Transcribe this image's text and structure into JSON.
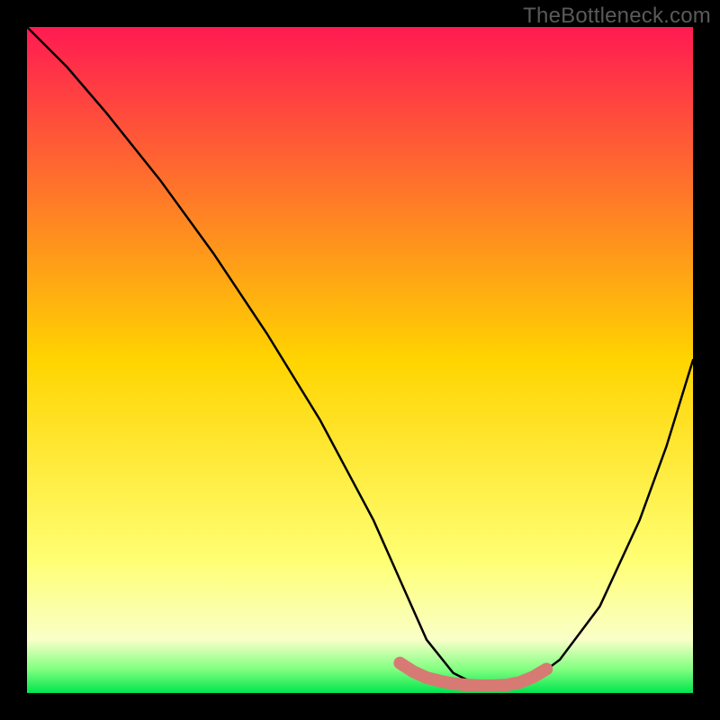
{
  "watermark": "TheBottleneck.com",
  "chart_data": {
    "type": "line",
    "title": "",
    "xlabel": "",
    "ylabel": "",
    "xlim": [
      0,
      100
    ],
    "ylim": [
      0,
      100
    ],
    "grid": false,
    "legend": false,
    "background_gradient": {
      "stops": [
        {
          "offset": 0.0,
          "color": "#ff1a52"
        },
        {
          "offset": 0.5,
          "color": "#ffd400"
        },
        {
          "offset": 0.8,
          "color": "#ffff73"
        },
        {
          "offset": 0.92,
          "color": "#f9ffc8"
        },
        {
          "offset": 0.965,
          "color": "#7fff7f"
        },
        {
          "offset": 1.0,
          "color": "#00e54e"
        }
      ]
    },
    "series": [
      {
        "name": "bottleneck-curve",
        "color": "#000000",
        "x": [
          0,
          6,
          12,
          20,
          28,
          36,
          44,
          52,
          56,
          60,
          64,
          68,
          72,
          76,
          80,
          86,
          92,
          96,
          100
        ],
        "values": [
          100,
          94,
          87,
          77,
          66,
          54,
          41,
          26,
          17,
          8,
          3,
          1,
          1,
          2,
          5,
          13,
          26,
          37,
          50
        ]
      },
      {
        "name": "optimal-band-marker",
        "color": "#d77a73",
        "thick": true,
        "x": [
          56,
          58,
          60,
          62,
          64,
          66,
          68,
          70,
          72,
          74,
          76,
          78
        ],
        "values": [
          4.5,
          3.2,
          2.3,
          1.8,
          1.4,
          1.2,
          1.1,
          1.1,
          1.2,
          1.6,
          2.4,
          3.6
        ]
      }
    ],
    "annotations": []
  }
}
